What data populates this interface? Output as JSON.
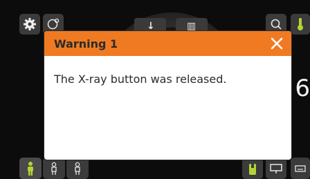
{
  "dialog": {
    "title": "Warning 1",
    "message": "The X-ray button was released."
  },
  "right_readout": {
    "value": "6"
  },
  "icons": {
    "settings": "gear-icon",
    "patient_settings": "person-gear-icon",
    "search": "search-icon",
    "thermometer": "thermometer-icon",
    "close": "close-icon"
  },
  "colors": {
    "header": "#f07a22",
    "accent_green": "#b4d334",
    "button_bg": "#3b3b3b",
    "background": "#0c0c0c"
  }
}
